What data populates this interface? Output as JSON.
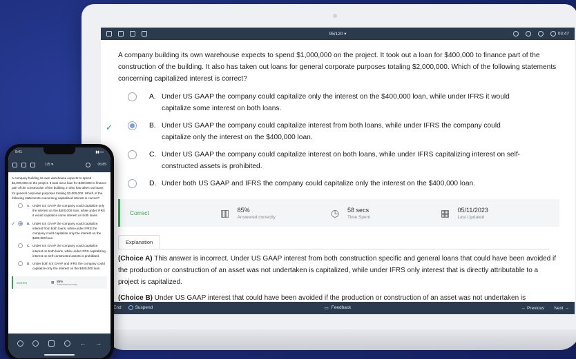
{
  "app": {
    "counter": "95/120",
    "timer": "03:47"
  },
  "question": "A company building its own warehouse expects to spend $1,000,000 on the project. It took out a loan for $400,000 to finance part of the construction of the building. It also has taken out loans for general corporate purposes totaling $2,000,000. Which of the following statements concerning capitalized interest is correct?",
  "choices": [
    {
      "letter": "A.",
      "text": "Under US GAAP the company could capitalize only the interest on the $400,000 loan, while under IFRS it would capitalize some interest on both loans."
    },
    {
      "letter": "B.",
      "text": "Under US GAAP the company could capitalize interest from both loans, while under IFRS the company could capitalize only the interest on the $400,000 loan."
    },
    {
      "letter": "C.",
      "text": "Under US GAAP the company could capitalize interest on both loans, while under IFRS capitalizing interest on self-constructed assets is prohibited."
    },
    {
      "letter": "D.",
      "text": "Under both US GAAP and IFRS the company could capitalize only the interest on the $400,000 loan."
    }
  ],
  "stats": {
    "result": "Correct",
    "percent": "85%",
    "percent_label": "Answered correctly",
    "time": "58 secs",
    "time_label": "Time Spent",
    "date": "05/11/2023",
    "date_label": "Last Updated"
  },
  "explanation": {
    "tab": "Explanation",
    "a_head": "(Choice A)",
    "a_text": " This answer is incorrect. Under US GAAP interest from both construction specific and general loans that could have been avoided if the production or construction of an asset was not undertaken is capitalized, while under IFRS only interest that is directly attributable to a project is capitalized.",
    "b_head": "(Choice B)",
    "b_text": " Under US GAAP interest that could have been avoided if the production or construction of an asset was not undertaken is"
  },
  "bottombar": {
    "end": "End",
    "suspend": "Suspend",
    "feedback": "Feedback",
    "previous": "Previous",
    "next": "Next"
  },
  "phone": {
    "clock": "9:41",
    "counter": "1/5",
    "timer": "05:85",
    "question": "A company building its own warehouse expects to spend $1,000,000 on the project. It took out a loan for $400,000 to finance part of the construction of the building. It also has taken out loans for general corporate purposes totaling $2,000,000. Which of the following statements concerning capitalized interest is correct?",
    "choices": [
      {
        "letter": "A.",
        "text": "Under US GAAP the company could capitalize only the interest on the $400,000 loan, while under IFRS it would capitalize some interest on both loans."
      },
      {
        "letter": "B.",
        "text": "Under US GAAP the company could capitalize interest from both loans, while under IFRS the company could capitalize only the interest on the $400,000 loan."
      },
      {
        "letter": "C.",
        "text": "Under US GAAP the company could capitalize interest on both loans, while under IFRS capitalizing interest on self-constructed assets is prohibited."
      },
      {
        "letter": "D.",
        "text": "Under both US GAAP and IFRS the company could capitalize only the interest on the $400,000 loan."
      }
    ],
    "result": "Correct",
    "percent": "85%",
    "percent_label": "Answered correctly"
  },
  "colors": {
    "accent_green": "#2ea44f",
    "bar_dark": "#2b3a4c",
    "background": "#1d2c7a"
  }
}
